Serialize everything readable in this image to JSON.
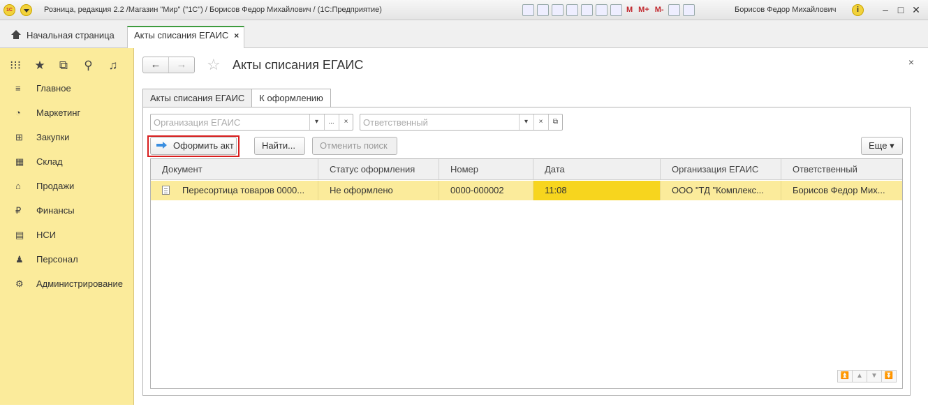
{
  "titlebar": {
    "title": "Розница, редакция 2.2 /Магазин \"Мир\" (\"1С\") / Борисов Федор Михайлович /  (1С:Предприятие)",
    "user": "Борисов Федор Михайлович",
    "logo": "1С",
    "m_labels": [
      "M",
      "M+",
      "M-"
    ],
    "info": "i",
    "minimize": "–",
    "restore": "□",
    "close": "✕"
  },
  "tabs": {
    "home": "Начальная страница",
    "doc": "Акты списания ЕГАИС",
    "doc_close": "×"
  },
  "sidebar": {
    "icons": [
      "apps-grid-icon",
      "star-icon",
      "history-icon",
      "search-icon",
      "bell-icon"
    ],
    "items": [
      {
        "label": "Главное",
        "icon": "≡"
      },
      {
        "label": "Маркетинг",
        "icon": "◔"
      },
      {
        "label": "Закупки",
        "icon": "⊞"
      },
      {
        "label": "Склад",
        "icon": "▦"
      },
      {
        "label": "Продажи",
        "icon": "⌂"
      },
      {
        "label": "Финансы",
        "icon": "₽"
      },
      {
        "label": "НСИ",
        "icon": "▤"
      },
      {
        "label": "Персонал",
        "icon": "♟"
      },
      {
        "label": "Администрирование",
        "icon": "⚙"
      }
    ]
  },
  "form": {
    "title": "Акты списания ЕГАИС",
    "close": "×",
    "nav_back": "←",
    "nav_forward": "→",
    "star": "☆",
    "tabs": [
      "Акты списания ЕГАИС",
      "К оформлению"
    ],
    "filter_org_placeholder": "Организация ЕГАИС",
    "filter_resp_placeholder": "Ответственный",
    "field_buttons": {
      "dropdown": "▾",
      "more": "...",
      "clear": "×",
      "open": "⧉"
    },
    "buttons": {
      "primary": "Оформить акт",
      "find": "Найти...",
      "cancel_search": "Отменить поиск",
      "more": "Еще ▾"
    }
  },
  "table": {
    "columns": [
      "Документ",
      "Статус оформления",
      "Номер",
      "Дата",
      "Организация ЕГАИС",
      "Ответственный"
    ],
    "rows": [
      [
        "Пересортица товаров 0000...",
        "Не оформлено",
        "0000-000002",
        "11:08",
        "ООО \"ТД \"Комплекс...",
        "Борисов Федор Мих..."
      ]
    ],
    "scroll_buttons": [
      "⏫",
      "▲",
      "▼",
      "⏬"
    ]
  }
}
